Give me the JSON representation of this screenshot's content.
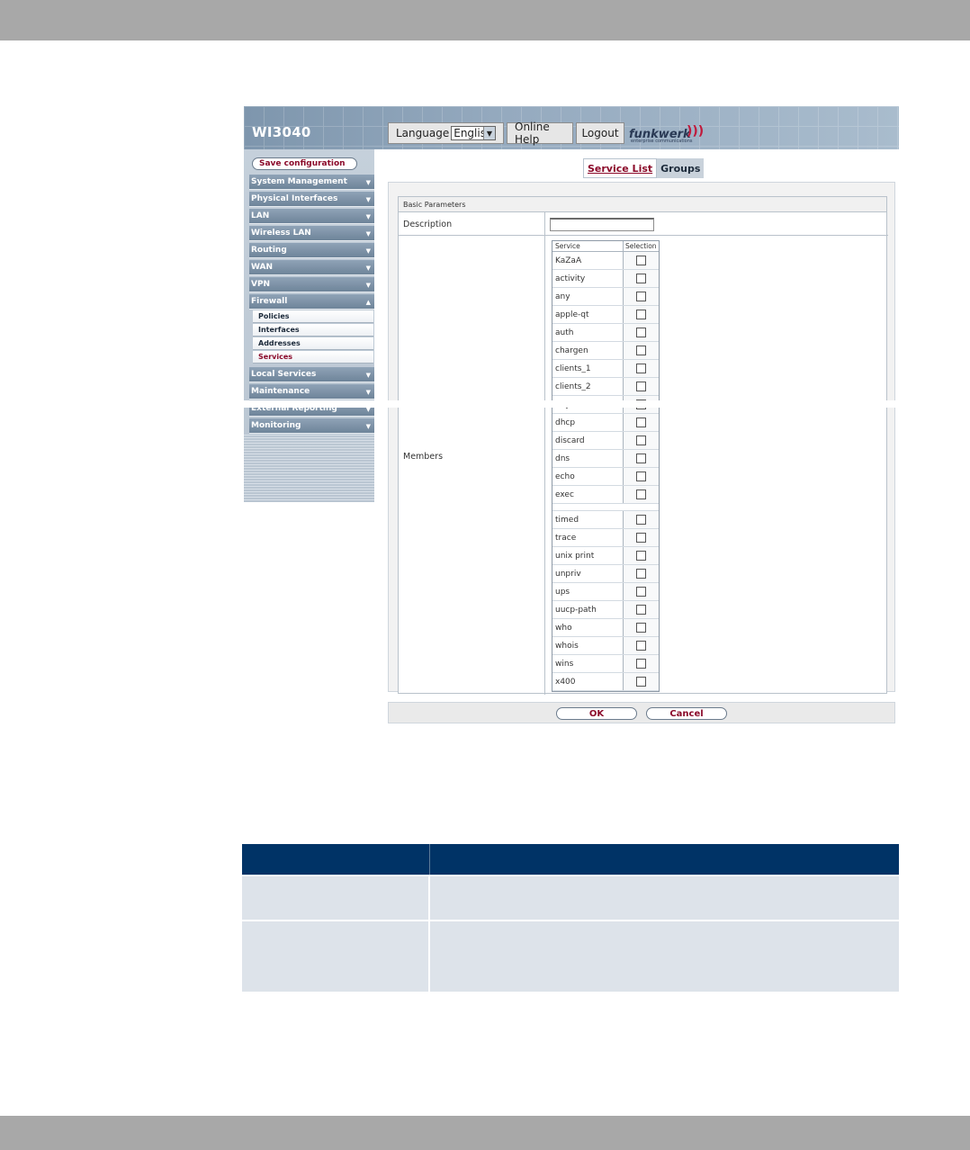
{
  "header": {
    "device_name": "WI3040",
    "language_label": "Language",
    "language_value": "English",
    "help_label": "Online Help",
    "logout_label": "Logout",
    "logo_text": "funkwerk",
    "logo_sub": "enterprise communications"
  },
  "sidebar": {
    "save_label": "Save configuration",
    "menus": [
      {
        "label": "System Management"
      },
      {
        "label": "Physical Interfaces"
      },
      {
        "label": "LAN"
      },
      {
        "label": "Wireless LAN"
      },
      {
        "label": "Routing"
      },
      {
        "label": "WAN"
      },
      {
        "label": "VPN"
      },
      {
        "label": "Firewall"
      },
      {
        "label": "Local Services"
      },
      {
        "label": "Maintenance"
      },
      {
        "label": "External Reporting"
      },
      {
        "label": "Monitoring"
      }
    ],
    "firewall_sub": [
      {
        "label": "Policies"
      },
      {
        "label": "Interfaces"
      },
      {
        "label": "Addresses"
      },
      {
        "label": "Services"
      }
    ]
  },
  "tabs": [
    {
      "label": "Service List"
    },
    {
      "label": "Groups"
    }
  ],
  "form": {
    "section_title": "Basic Parameters",
    "description_label": "Description",
    "description_value": "",
    "members_label": "Members",
    "table_headers": {
      "service": "Service",
      "selection": "Selection"
    },
    "services_top": [
      "KaZaA",
      "activity",
      "any",
      "apple-qt",
      "auth",
      "chargen",
      "clients_1",
      "clients_2",
      "daytime",
      "dhcp",
      "discard",
      "dns",
      "echo",
      "exec"
    ],
    "services_bottom": [
      "timed",
      "trace",
      "unix print",
      "unpriv",
      "ups",
      "uucp-path",
      "who",
      "whois",
      "wins",
      "x400"
    ]
  },
  "buttons": {
    "ok": "OK",
    "cancel": "Cancel"
  },
  "colors": {
    "accent": "#8b0a2a",
    "menu": "#7d92a7",
    "doc_header": "#003366",
    "doc_row": "#dde3ea"
  }
}
